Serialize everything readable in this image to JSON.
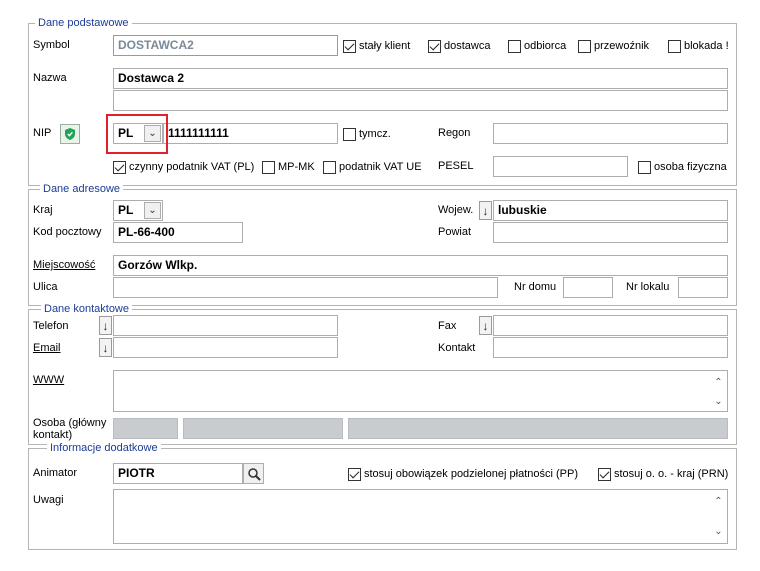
{
  "sections": {
    "basic": "Dane podstawowe",
    "address": "Dane adresowe",
    "contact": "Dane kontaktowe",
    "extra": "Informacje dodatkowe"
  },
  "basic": {
    "symbol_label": "Symbol",
    "symbol_value": "DOSTAWCA2",
    "checks": [
      {
        "label": "stały klient",
        "checked": true
      },
      {
        "label": "dostawca",
        "checked": true
      },
      {
        "label": "odbiorca",
        "checked": false
      },
      {
        "label": "przewoźnik",
        "checked": false
      },
      {
        "label": "blokada !",
        "checked": false
      }
    ],
    "name_label": "Nazwa",
    "name_value": "Dostawca 2",
    "name_value2": "",
    "nip_label": "NIP",
    "nip_country": "PL",
    "nip_value": "1111111111",
    "tymcz_label": "tymcz.",
    "regon_label": "Regon",
    "regon_value": "",
    "vat_checks": [
      {
        "label": "czynny podatnik VAT (PL)",
        "checked": true
      },
      {
        "label": "MP-MK",
        "checked": false
      },
      {
        "label": "podatnik VAT UE",
        "checked": false
      }
    ],
    "pesel_label": "PESEL",
    "pesel_value": "",
    "osoba_label": "osoba fizyczna"
  },
  "address": {
    "kraj_label": "Kraj",
    "kraj_value": "PL",
    "kod_label": "Kod pocztowy",
    "kod_value": "PL-66-400",
    "woj_label": "Wojew.",
    "woj_value": "lubuskie",
    "powiat_label": "Powiat",
    "powiat_value": "",
    "miejsc_label": "Miejscowość",
    "miejsc_value": "Gorzów Wlkp.",
    "ulica_label": "Ulica",
    "ulica_value": "",
    "nrdomu_label": "Nr domu",
    "nrdomu_value": "",
    "nrlokalu_label": "Nr lokalu",
    "nrlokalu_value": ""
  },
  "contact": {
    "telefon_label": "Telefon",
    "email_label": "Email",
    "fax_label": "Fax",
    "kontakt_label": "Kontakt",
    "www_label": "WWW",
    "osoba_label1": "Osoba (główny",
    "osoba_label2": "kontakt)"
  },
  "extra": {
    "animator_label": "Animator",
    "animator_value": "PIOTR",
    "pp_label": "stosuj obowiązek podzielonej płatności (PP)",
    "pp_checked": true,
    "prn_label": "stosuj o. o. - kraj (PRN)",
    "prn_checked": true,
    "uwagi_label": "Uwagi"
  },
  "icons": {
    "arrow": "↓",
    "dropdown": "⌄",
    "scroll_up": "⌃",
    "scroll_down": "⌄"
  }
}
